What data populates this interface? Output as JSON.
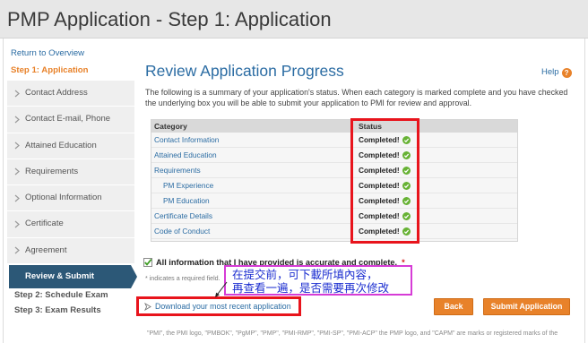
{
  "header": {
    "title": "PMP Application - Step 1: Application"
  },
  "sidebar": {
    "return_link": "Return to Overview",
    "current_step": "Step 1: Application",
    "items": [
      {
        "label": "Contact Address"
      },
      {
        "label": "Contact E-mail, Phone"
      },
      {
        "label": "Attained Education"
      },
      {
        "label": "Requirements"
      },
      {
        "label": "Optional Information"
      },
      {
        "label": "Certificate"
      },
      {
        "label": "Agreement"
      }
    ],
    "active_item": {
      "label": "Review & Submit"
    },
    "next_steps": [
      "Step 2: Schedule Exam",
      "Step 3: Exam Results"
    ]
  },
  "main": {
    "title": "Review Application Progress",
    "help": {
      "label": "Help"
    },
    "intro": "The following is a summary of your application's status. When each category is marked complete and you have checked the underlying box you will be able to submit your application to PMI for review and approval.",
    "table": {
      "headers": {
        "category": "Category",
        "status": "Status"
      },
      "rows": [
        {
          "category": "Contact Information",
          "status": "Completed!",
          "sub_item": false
        },
        {
          "category": "Attained Education",
          "status": "Completed!",
          "sub_item": false
        },
        {
          "category": "Requirements",
          "status": "Completed!",
          "sub_item": false
        },
        {
          "category": "PM Experience",
          "status": "Completed!",
          "sub_item": true
        },
        {
          "category": "PM Education",
          "status": "Completed!",
          "sub_item": true
        },
        {
          "category": "Certificate Details",
          "status": "Completed!",
          "sub_item": false
        },
        {
          "category": "Code of Conduct",
          "status": "Completed!",
          "sub_item": false
        }
      ]
    },
    "confirmation": {
      "label": "All information that I have provided is accurate and complete.",
      "required_mark": "*",
      "checked": true
    },
    "required_note": "* indicates a required field.",
    "download_link": "Download your most recent application",
    "buttons": {
      "back": "Back",
      "submit": "Submit Application"
    },
    "footer": "\"PMI\", the PMI logo, \"PMBOK\", \"PgMP\", \"PMP\", \"PMI-RMP\", \"PMI-SP\", \"PMI-ACP\" the PMP logo, and \"CAPM\" are marks or registered marks of the"
  },
  "annotation": {
    "note_lines": [
      "在提交前，可下載所填內容，",
      "再查看一遍，是否需要再次修改"
    ]
  },
  "icons": {
    "nav_chevron": "chevron-right-icon",
    "help": "help-icon",
    "status_complete": "check-circle-icon",
    "confirmation_checkbox": "checkbox-checked-icon",
    "download": "download-icon",
    "annotation_pointer": "arrow-icon"
  },
  "colors": {
    "link_blue": "#2b6ca3",
    "accent_orange": "#e8822a",
    "success_green": "#67b234",
    "active_nav": "#2c5877",
    "highlight_red": "#e8141c",
    "note_border_magenta": "#d63cd6",
    "note_text_blue": "#1c2ed0"
  }
}
